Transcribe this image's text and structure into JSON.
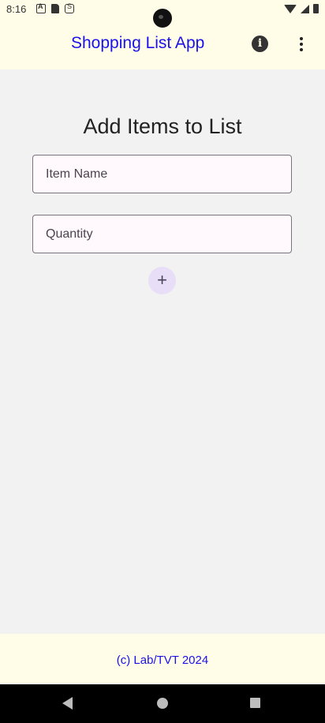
{
  "status_bar": {
    "time": "8:16",
    "left_icons": [
      "font-a-icon",
      "sd-card-icon",
      "sync-icon"
    ],
    "right_icons": [
      "wifi-icon",
      "signal-icon",
      "battery-icon"
    ]
  },
  "app_bar": {
    "title": "Shopping List App",
    "title_color": "#1a12e8",
    "background": "#fffde7",
    "actions": [
      "info-icon",
      "more-vert-icon"
    ]
  },
  "main": {
    "heading": "Add Items to List",
    "item_name_field": {
      "placeholder": "Item Name",
      "value": ""
    },
    "quantity_field": {
      "placeholder": "Quantity",
      "value": ""
    },
    "add_button": {
      "label": "+",
      "icon": "plus-icon",
      "color": "#e8def8"
    }
  },
  "footer": {
    "text": "(c) Lab/TVT 2024"
  },
  "nav_bar": {
    "buttons": [
      "back-icon",
      "home-icon",
      "recents-icon"
    ]
  }
}
